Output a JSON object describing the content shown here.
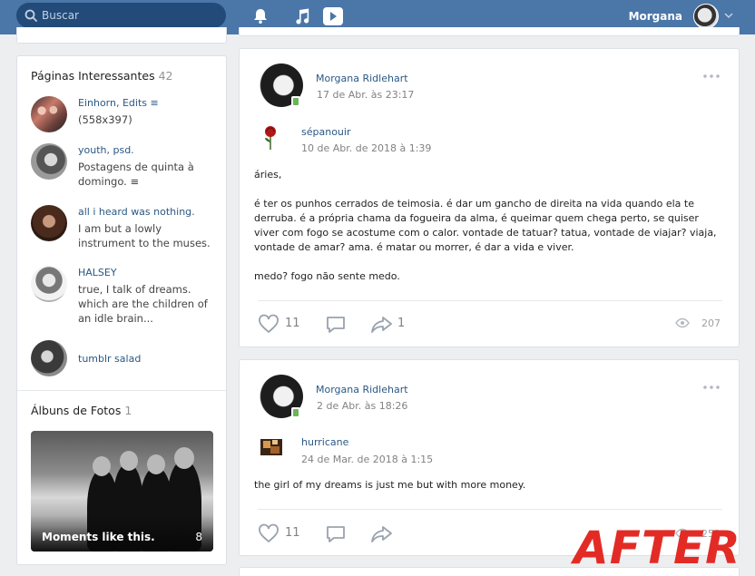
{
  "search": {
    "placeholder": "Buscar"
  },
  "topbar": {
    "user_name": "Morgana"
  },
  "pages_block": {
    "title": "Páginas Interessantes",
    "count": "42",
    "items": [
      {
        "name": "Einhorn, Edits ≡",
        "desc": "(558x397)"
      },
      {
        "name": "youth, psd.",
        "desc": "Postagens de quinta à domingo. ≡"
      },
      {
        "name": "all i heard was nothing.",
        "desc": "I am but a lowly instrument to the muses."
      },
      {
        "name": "HALSEY",
        "desc": "true, I talk of dreams. which are the children of an idle brain..."
      },
      {
        "name": "tumblr salad",
        "desc": ""
      }
    ]
  },
  "albums_block": {
    "title": "Álbuns de Fotos",
    "count": "1",
    "album": {
      "title": "Moments like this.",
      "count": "8"
    }
  },
  "posts": [
    {
      "author": "Morgana Ridlehart",
      "date": "17 de Abr. às 23:17",
      "repost_name": "sépanouir",
      "repost_date": "10 de Abr. de 2018 à 1:39",
      "paragraphs": [
        "áries,",
        "é ter os punhos cerrados de teimosia. é dar um gancho de direita na vida quando ela te derruba. é a própria chama da fogueira da alma, é queimar quem chega perto, se quiser viver com fogo se acostume com o calor. vontade de tatuar? tatua, vontade de viajar? viaja, vontade de amar? ama. é matar ou morrer, é dar a vida e viver.",
        "medo? fogo não sente medo."
      ],
      "likes": "11",
      "shares": "1",
      "views": "207"
    },
    {
      "author": "Morgana Ridlehart",
      "date": "2 de Abr. às 18:26",
      "repost_name": "hurricane",
      "repost_date": "24 de Mar. de 2018 à 1:15",
      "paragraphs": [
        "the girl of my dreams is just me but with more money."
      ],
      "likes": "11",
      "shares": "",
      "views": "251"
    }
  ],
  "watermark": "AFTER",
  "colors": {
    "header": "#4a76a8",
    "search_bg": "#224b7a",
    "link": "#2a5885",
    "background": "#edeef0",
    "watermark": "#e32b26"
  }
}
